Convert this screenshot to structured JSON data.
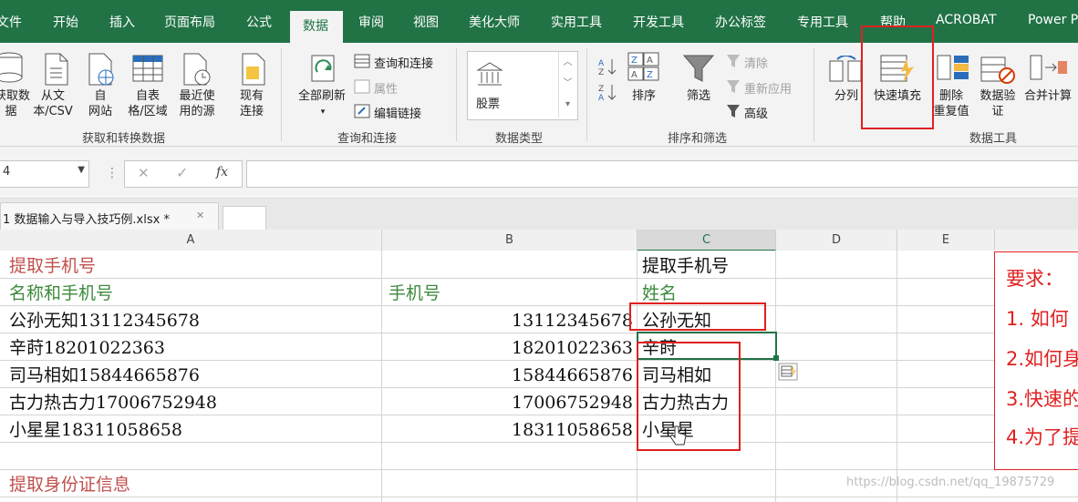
{
  "ribbon_tabs": [
    "文件",
    "开始",
    "插入",
    "页面布局",
    "公式",
    "数据",
    "审阅",
    "视图",
    "美化大师",
    "实用工具",
    "开发工具",
    "办公标签",
    "专用工具",
    "帮助",
    "ACROBAT",
    "Power P"
  ],
  "active_tab": "数据",
  "ribbon": {
    "get_data_label": "获取数\n据",
    "from_csv_label": "从文\n本/CSV",
    "from_web_label": "自\n网站",
    "from_table_label": "自表\n格/区域",
    "recent_sources_label": "最近使\n用的源",
    "existing_conn_label": "现有\n连接",
    "group_get_transform": "获取和转换数据",
    "refresh_all_label": "全部刷新",
    "queries_conn_label": "查询和连接",
    "properties_label": "属性",
    "edit_links_label": "编辑链接",
    "group_queries": "查询和连接",
    "stocks_label": "股票",
    "group_data_types": "数据类型",
    "sort_label": "排序",
    "filter_label": "筛选",
    "clear_label": "清除",
    "reapply_label": "重新应用",
    "advanced_label": "高级",
    "group_sort_filter": "排序和筛选",
    "split_label": "分列",
    "flash_fill_label": "快速填充",
    "remove_dup_label": "删除\n重复值",
    "validation_label": "数据验\n证",
    "consolidate_label": "合并计算",
    "group_data_tools": "数据工具"
  },
  "formula_bar": {
    "name_box": "4",
    "cancel_symbol": "✕",
    "enter_symbol": "✓",
    "fx_label": "fx",
    "formula": ""
  },
  "workbook_tab": "1 数据输入与导入技巧例.xlsx *",
  "workbook_close": "✕",
  "columns": [
    "A",
    "B",
    "C",
    "D",
    "E"
  ],
  "sheet": {
    "row1_a": "提取手机号",
    "row1_c": "提取手机号",
    "row2_a": "名称和手机号",
    "row2_b": "手机号",
    "row2_c": "姓名",
    "rows": [
      {
        "a": "公孙无知13112345678",
        "b": "13112345678",
        "c": "公孙无知"
      },
      {
        "a": "辛莳18201022363",
        "b": "18201022363",
        "c": "辛莳"
      },
      {
        "a": "司马相如15844665876",
        "b": "15844665876",
        "c": "司马相如"
      },
      {
        "a": "古力热古力17006752948",
        "b": "17006752948",
        "c": "古力热古力"
      },
      {
        "a": "小星星18311058658",
        "b": "18311058658",
        "c": "小星星"
      }
    ],
    "row9_a": "提取身份证信息"
  },
  "requirements": [
    "要求：",
    "1. 如何",
    "2.如何身",
    "3.快速的",
    "4.为了提"
  ],
  "watermark": "https://blog.csdn.net/qq_19875729",
  "colors": {
    "excel_green": "#217346",
    "highlight_red": "#e02020",
    "title_red": "#c0504d",
    "header_green": "#3c8a3c"
  }
}
